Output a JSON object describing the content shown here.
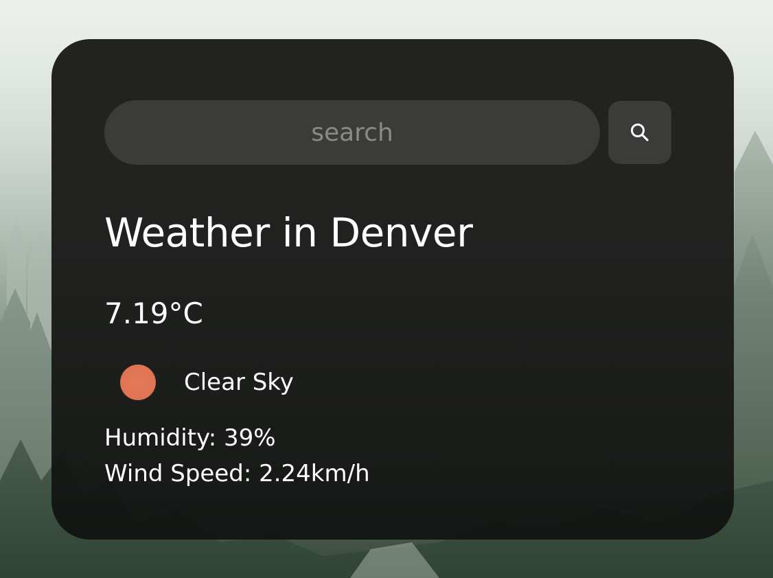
{
  "search": {
    "placeholder": "search",
    "value": "",
    "button_icon": "search-icon"
  },
  "weather": {
    "title": "Weather in Denver",
    "temperature": "7.19°C",
    "condition_icon": "clear-sky-sun-icon",
    "condition": "Clear Sky",
    "humidity": "Humidity: 39%",
    "wind": "Wind Speed: 2.24km/h"
  },
  "colors": {
    "card_background": "#1e1e1c",
    "input_background": "#3b3b39",
    "placeholder_text": "#8a8a86",
    "text": "#ffffff",
    "sun_icon": "#df7454"
  }
}
